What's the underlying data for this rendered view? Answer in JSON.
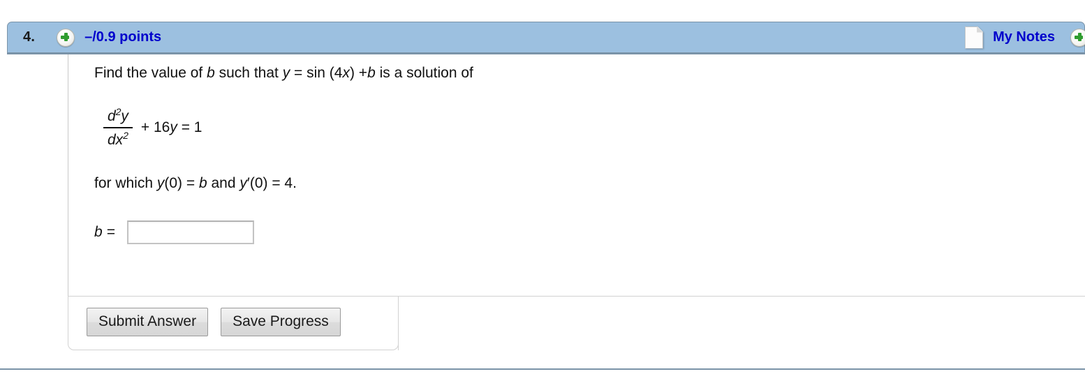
{
  "header": {
    "question_number": "4.",
    "add_icon": "plus-circle-icon",
    "points": "–/0.9 points",
    "notes_icon": "note-page-icon",
    "notes_label": "My Notes",
    "notes_add_icon": "plus-circle-icon",
    "bar_color": "#9cc0e0",
    "link_color": "#0000cc",
    "border_color": "#7a93a8"
  },
  "question": {
    "prompt_parts": {
      "p1": "Find the value of ",
      "v1": "b",
      "p2": " such that ",
      "v2": "y",
      "p3": " = sin (4",
      "v3": "x",
      "p4": ") +",
      "v4": "b",
      "p5": " is a solution of"
    },
    "equation": {
      "numerator": "d",
      "numerator_sup": "2",
      "numerator_var": "y",
      "denominator": "dx",
      "denominator_sup": "2",
      "rest_a": " + 16",
      "rest_var": "y",
      "rest_b": " = 1"
    },
    "condition_parts": {
      "c1": "for which ",
      "cv1": "y",
      "c2": "(0) = ",
      "cv2": "b",
      "c3": " and ",
      "cv3": "y",
      "c4": "′(0) = 4."
    },
    "answer": {
      "label": "b  =",
      "value": "",
      "placeholder": ""
    }
  },
  "actions": {
    "submit_label": "Submit Answer",
    "save_label": "Save Progress"
  }
}
